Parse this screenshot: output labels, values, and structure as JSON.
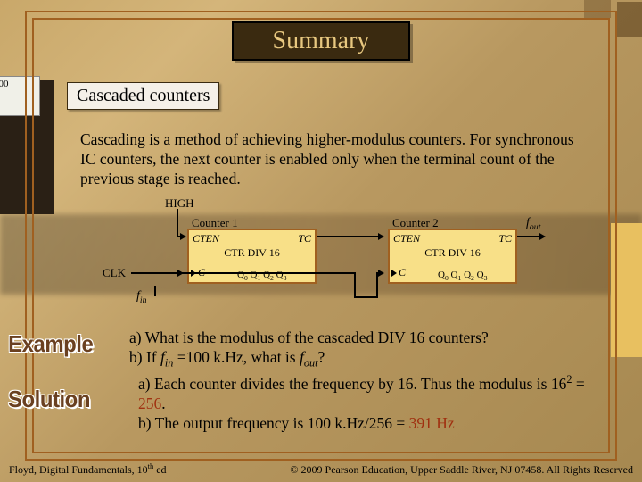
{
  "title": "Summary",
  "subtitle": "Cascaded counters",
  "body": "Cascading is a method of achieving higher-modulus counters. For synchronous IC counters, the next counter is enabled only when the terminal count of the previous stage is reached.",
  "diagram": {
    "high": "HIGH",
    "counter1_label": "Counter 1",
    "counter2_label": "Counter 2",
    "cten": "CTEN",
    "tc": "TC",
    "divlabel": "CTR DIV 16",
    "c_pin": "C",
    "q_pins": [
      "Q",
      "Q",
      "Q",
      "Q"
    ],
    "q_subs": [
      "0",
      "1",
      "2",
      "3"
    ],
    "clk": "CLK",
    "fin_html": "f<sub>in</sub>",
    "fout_html": "f<sub>out</sub>"
  },
  "example_label": "Example",
  "solution_label": "Solution",
  "question_a": "a)  What is the modulus of the cascaded DIV 16 counters?",
  "question_b_pre": "b)  If ",
  "question_b_fin": "f",
  "question_b_fin_sub": "in",
  "question_b_mid": " =100 k.Hz, what is ",
  "question_b_fout": "f",
  "question_b_fout_sub": "out",
  "question_b_end": "?",
  "answer_a_pre": "a)  Each counter divides the frequency by 16. Thus the modulus is 16",
  "answer_a_exp": "2",
  "answer_a_mid": " = ",
  "answer_a_val": "256",
  "answer_a_end": ".",
  "answer_b_pre": "b)  The output frequency is 100 k.Hz/256 = ",
  "answer_b_val": "391 Hz",
  "footer_left_pre": "Floyd, Digital Fundamentals, 10",
  "footer_left_th": "th",
  "footer_left_end": " ed",
  "footer_right": "© 2009 Pearson Education, Upper Saddle River, NJ 07458. All Rights Reserved"
}
